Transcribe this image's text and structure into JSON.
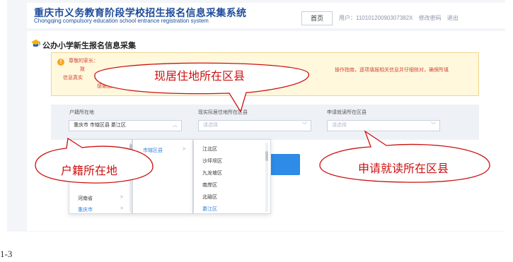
{
  "header": {
    "title_cn": "重庆市义务教育阶段学校招生报名信息采集系统",
    "title_en": "Chongqing compulsory education school entrance registration system",
    "home_label": "首页",
    "user_label": "用户：11010120090307382X",
    "change_password": "修改密码",
    "logout": "退出"
  },
  "section": {
    "title": "公办小学新生报名信息采集",
    "icon": "graduation-cap-icon"
  },
  "notice": {
    "line1": "尊敬的家长：",
    "line2": "致",
    "line3": "信息真实",
    "line4": "感谢您的配",
    "line_right": "操作指南，逐项填报相关信息并仔细核对，确保所填"
  },
  "form": {
    "household": {
      "label": "户籍所在地",
      "value": "重庆市 市辖区县 綦江区"
    },
    "residence": {
      "label": "现实际居住地所在区县",
      "placeholder": "请选择"
    },
    "apply": {
      "label": "申请就读所在区县",
      "placeholder": "请选择"
    }
  },
  "cascader": {
    "col1": [
      {
        "label": "河南省"
      },
      {
        "label": "重庆市",
        "active": true
      }
    ],
    "col2": [
      {
        "label": "市辖区县",
        "active": true
      }
    ],
    "col3": [
      {
        "label": "江北区"
      },
      {
        "label": "沙坪坝区"
      },
      {
        "label": "九龙坡区"
      },
      {
        "label": "南岸区"
      },
      {
        "label": "北碚区"
      },
      {
        "label": "綦江区",
        "active": true
      }
    ]
  },
  "callouts": {
    "residence": "现居住地所在区县",
    "household": "户籍所在地",
    "apply": "申请就读所在区县"
  },
  "caption": "1-3",
  "colors": {
    "brand": "#1f4d9b",
    "accent": "#2e8be6",
    "callout": "#cc1111",
    "notice_bg": "#fff8dc"
  }
}
